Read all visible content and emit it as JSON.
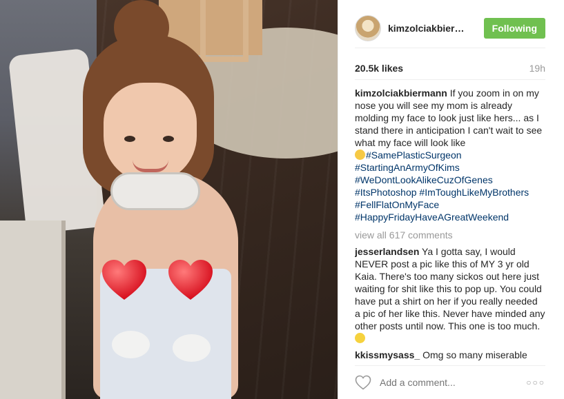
{
  "header": {
    "username": "kimzolciakbierm...",
    "follow_label": "Following"
  },
  "stats": {
    "likes": "20.5k likes",
    "time": "19h"
  },
  "caption": {
    "user": "kimzolciakbiermann",
    "text": "If you zoom in on my nose you will see my mom is already molding my face to look just like hers... as I stand there in anticipation I can't wait to see what my face will look like",
    "hashtags": [
      "#SamePlasticSurgeon",
      "#StartingAnArmyOfKims",
      "#WeDontLookAlikeCuzOfGenes",
      "#ItsPhotoshop",
      "#ImToughLikeMyBrothers",
      "#FellFlatOnMyFace",
      "#HappyFridayHaveAGreatWeekend"
    ]
  },
  "view_all": "view all 617 comments",
  "comments": [
    {
      "user": "jesserlandsen",
      "text": "Ya I gotta say, I would NEVER post a pic like this of MY 3 yr old Kaia. There's too many sickos out here just waiting for shit like this to pop up. You could have put a shirt on her if you really needed a pic of her like this. Never have minded any other posts until now. This one is too much."
    },
    {
      "user": "kkissmysass_",
      "text": "Omg so many miserable"
    }
  ],
  "add_comment": {
    "placeholder": "Add a comment..."
  },
  "icons": {
    "like": "heart-outline-icon",
    "more": "more-options-icon",
    "emoji_hug": "hugging-face-emoji",
    "emoji_confused": "confused-face-emoji",
    "censor": "red-heart-emoji"
  },
  "colors": {
    "follow_button": "#70c050",
    "hashtag": "#003569",
    "muted": "#999999"
  }
}
